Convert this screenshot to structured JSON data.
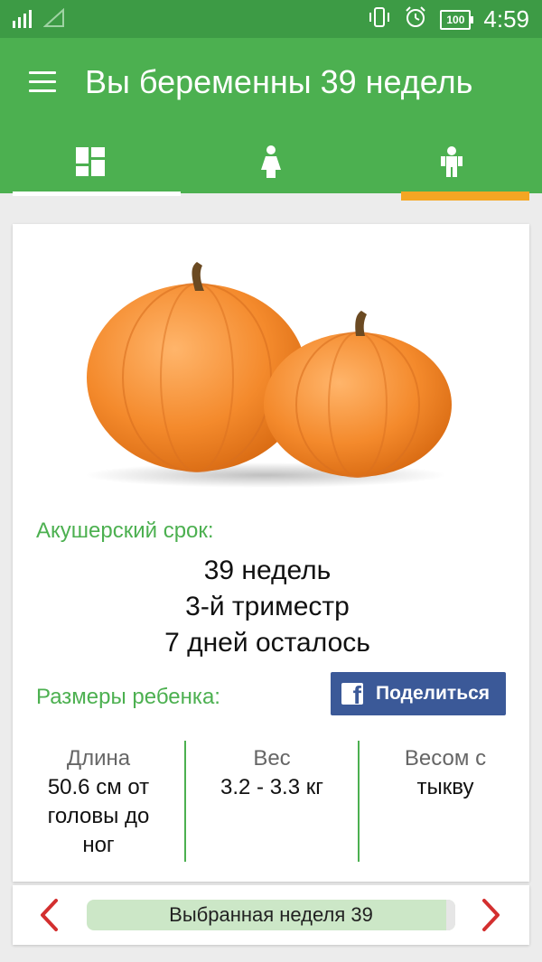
{
  "status_bar": {
    "time": "4:59",
    "battery": "100",
    "icons": [
      "signal-icon",
      "no-signal-icon",
      "vibrate-icon",
      "alarm-icon",
      "battery-icon"
    ]
  },
  "app_bar": {
    "title": "Вы беременны 39 недель",
    "tabs": [
      {
        "icon": "dashboard-icon"
      },
      {
        "icon": "mother-icon"
      },
      {
        "icon": "baby-icon"
      }
    ],
    "tab_indicator_color": "#f5a623"
  },
  "card": {
    "image": "pumpkins",
    "term_label": "Акушерский срок:",
    "weeks": "39 недель",
    "trimester": "3-й триместр",
    "days_left": "7 дней осталось",
    "baby_size_label": "Размеры ребенка:",
    "share_button": "Поделиться",
    "stats": [
      {
        "header": "Длина",
        "value": "50.6 см от головы до ног"
      },
      {
        "header": "Вес",
        "value": "3.2 - 3.3 кг"
      },
      {
        "header": "Весом с",
        "value": "тыкву"
      }
    ]
  },
  "bottom_bar": {
    "selected_week_text": "Выбранная неделя 39",
    "prev_icon": "chevron-left-icon",
    "next_icon": "chevron-right-icon"
  },
  "colors": {
    "status_bar": "#3d9b45",
    "app_bar": "#4cb050",
    "accent_green": "#4cb050",
    "facebook": "#3b5998",
    "arrows": "#d32f2f"
  }
}
